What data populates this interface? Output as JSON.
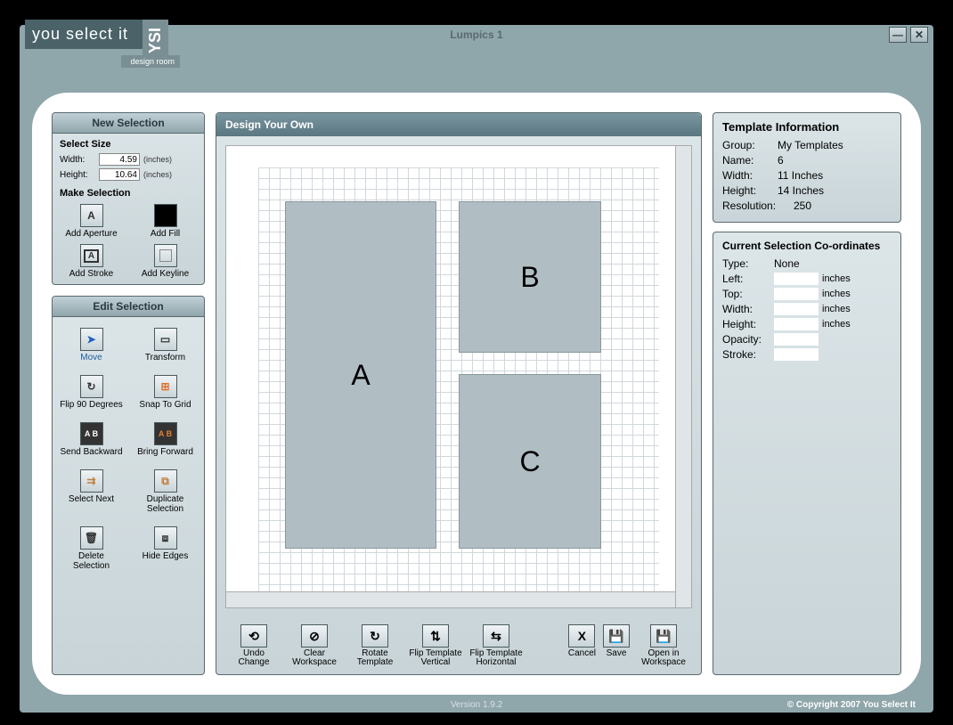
{
  "window": {
    "title": "Lumpics 1"
  },
  "logo": {
    "main": "you select it",
    "badge": "YSI",
    "sub": "design room"
  },
  "left": {
    "newSelection": {
      "header": "New Selection",
      "selectSizeLabel": "Select Size",
      "widthLabel": "Width:",
      "widthValue": "4.59",
      "widthUnit": "(inches)",
      "heightLabel": "Height:",
      "heightValue": "10.64",
      "heightUnit": "(inches)",
      "makeSelectionLabel": "Make Selection",
      "btns": {
        "addAperture": "Add Aperture",
        "addFill": "Add Fill",
        "addStroke": "Add Stroke",
        "addKeyline": "Add Keyline"
      }
    },
    "editSelection": {
      "header": "Edit Selection",
      "btns": {
        "move": "Move",
        "transform": "Transform",
        "flip90": "Flip 90 Degrees",
        "snapGrid": "Snap To Grid",
        "sendBack": "Send Backward",
        "bringFwd": "Bring Forward",
        "selectNext": "Select Next",
        "dupSel": "Duplicate Selection",
        "delSel": "Delete Selection",
        "hideEdges": "Hide Edges"
      }
    }
  },
  "center": {
    "header": "Design Your Own",
    "shapes": {
      "a": "A",
      "b": "B",
      "c": "C"
    },
    "toolbar": {
      "undo": "Undo Change",
      "clear": "Clear Workspace",
      "rotate": "Rotate Template",
      "flipV": "Flip Template Vertical",
      "flipH": "Flip Template Horizontal",
      "cancel": "Cancel",
      "save": "Save",
      "openWs": "Open in Workspace"
    }
  },
  "right": {
    "templateInfo": {
      "title": "Template Information",
      "groupK": "Group:",
      "groupV": "My Templates",
      "nameK": "Name:",
      "nameV": "6",
      "widthK": "Width:",
      "widthV": "11 Inches",
      "heightK": "Height:",
      "heightV": "14 Inches",
      "resK": "Resolution:",
      "resV": "250"
    },
    "coords": {
      "title": "Current Selection Co-ordinates",
      "typeK": "Type:",
      "typeV": "None",
      "leftK": "Left:",
      "topK": "Top:",
      "widthK": "Width:",
      "heightK": "Height:",
      "unit": "inches",
      "opacityK": "Opacity:",
      "strokeK": "Stroke:"
    }
  },
  "footer": {
    "version": "Version 1.9.2",
    "copyright": "© Copyright 2007 You Select It"
  }
}
